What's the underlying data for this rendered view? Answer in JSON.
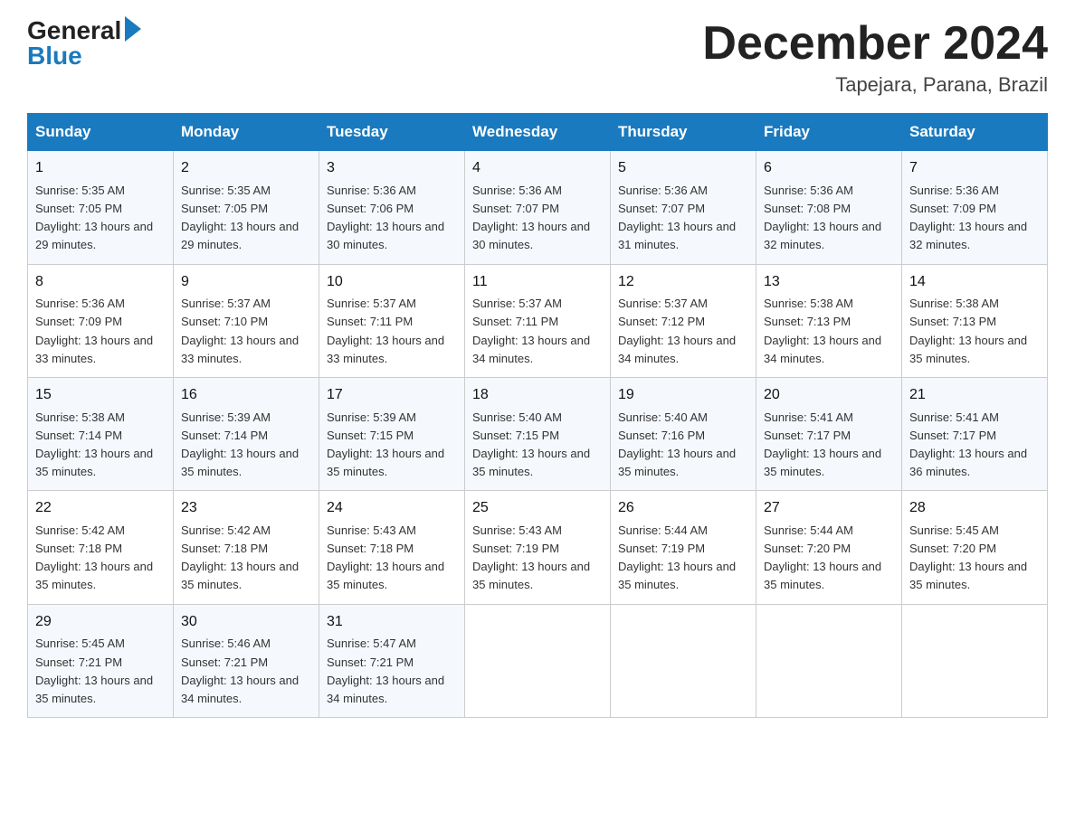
{
  "header": {
    "logo": {
      "general": "General",
      "blue": "Blue"
    },
    "title": "December 2024",
    "location": "Tapejara, Parana, Brazil"
  },
  "calendar": {
    "days_of_week": [
      "Sunday",
      "Monday",
      "Tuesday",
      "Wednesday",
      "Thursday",
      "Friday",
      "Saturday"
    ],
    "weeks": [
      [
        {
          "day": "1",
          "sunrise": "5:35 AM",
          "sunset": "7:05 PM",
          "daylight": "13 hours and 29 minutes."
        },
        {
          "day": "2",
          "sunrise": "5:35 AM",
          "sunset": "7:05 PM",
          "daylight": "13 hours and 29 minutes."
        },
        {
          "day": "3",
          "sunrise": "5:36 AM",
          "sunset": "7:06 PM",
          "daylight": "13 hours and 30 minutes."
        },
        {
          "day": "4",
          "sunrise": "5:36 AM",
          "sunset": "7:07 PM",
          "daylight": "13 hours and 30 minutes."
        },
        {
          "day": "5",
          "sunrise": "5:36 AM",
          "sunset": "7:07 PM",
          "daylight": "13 hours and 31 minutes."
        },
        {
          "day": "6",
          "sunrise": "5:36 AM",
          "sunset": "7:08 PM",
          "daylight": "13 hours and 32 minutes."
        },
        {
          "day": "7",
          "sunrise": "5:36 AM",
          "sunset": "7:09 PM",
          "daylight": "13 hours and 32 minutes."
        }
      ],
      [
        {
          "day": "8",
          "sunrise": "5:36 AM",
          "sunset": "7:09 PM",
          "daylight": "13 hours and 33 minutes."
        },
        {
          "day": "9",
          "sunrise": "5:37 AM",
          "sunset": "7:10 PM",
          "daylight": "13 hours and 33 minutes."
        },
        {
          "day": "10",
          "sunrise": "5:37 AM",
          "sunset": "7:11 PM",
          "daylight": "13 hours and 33 minutes."
        },
        {
          "day": "11",
          "sunrise": "5:37 AM",
          "sunset": "7:11 PM",
          "daylight": "13 hours and 34 minutes."
        },
        {
          "day": "12",
          "sunrise": "5:37 AM",
          "sunset": "7:12 PM",
          "daylight": "13 hours and 34 minutes."
        },
        {
          "day": "13",
          "sunrise": "5:38 AM",
          "sunset": "7:13 PM",
          "daylight": "13 hours and 34 minutes."
        },
        {
          "day": "14",
          "sunrise": "5:38 AM",
          "sunset": "7:13 PM",
          "daylight": "13 hours and 35 minutes."
        }
      ],
      [
        {
          "day": "15",
          "sunrise": "5:38 AM",
          "sunset": "7:14 PM",
          "daylight": "13 hours and 35 minutes."
        },
        {
          "day": "16",
          "sunrise": "5:39 AM",
          "sunset": "7:14 PM",
          "daylight": "13 hours and 35 minutes."
        },
        {
          "day": "17",
          "sunrise": "5:39 AM",
          "sunset": "7:15 PM",
          "daylight": "13 hours and 35 minutes."
        },
        {
          "day": "18",
          "sunrise": "5:40 AM",
          "sunset": "7:15 PM",
          "daylight": "13 hours and 35 minutes."
        },
        {
          "day": "19",
          "sunrise": "5:40 AM",
          "sunset": "7:16 PM",
          "daylight": "13 hours and 35 minutes."
        },
        {
          "day": "20",
          "sunrise": "5:41 AM",
          "sunset": "7:17 PM",
          "daylight": "13 hours and 35 minutes."
        },
        {
          "day": "21",
          "sunrise": "5:41 AM",
          "sunset": "7:17 PM",
          "daylight": "13 hours and 36 minutes."
        }
      ],
      [
        {
          "day": "22",
          "sunrise": "5:42 AM",
          "sunset": "7:18 PM",
          "daylight": "13 hours and 35 minutes."
        },
        {
          "day": "23",
          "sunrise": "5:42 AM",
          "sunset": "7:18 PM",
          "daylight": "13 hours and 35 minutes."
        },
        {
          "day": "24",
          "sunrise": "5:43 AM",
          "sunset": "7:18 PM",
          "daylight": "13 hours and 35 minutes."
        },
        {
          "day": "25",
          "sunrise": "5:43 AM",
          "sunset": "7:19 PM",
          "daylight": "13 hours and 35 minutes."
        },
        {
          "day": "26",
          "sunrise": "5:44 AM",
          "sunset": "7:19 PM",
          "daylight": "13 hours and 35 minutes."
        },
        {
          "day": "27",
          "sunrise": "5:44 AM",
          "sunset": "7:20 PM",
          "daylight": "13 hours and 35 minutes."
        },
        {
          "day": "28",
          "sunrise": "5:45 AM",
          "sunset": "7:20 PM",
          "daylight": "13 hours and 35 minutes."
        }
      ],
      [
        {
          "day": "29",
          "sunrise": "5:45 AM",
          "sunset": "7:21 PM",
          "daylight": "13 hours and 35 minutes."
        },
        {
          "day": "30",
          "sunrise": "5:46 AM",
          "sunset": "7:21 PM",
          "daylight": "13 hours and 34 minutes."
        },
        {
          "day": "31",
          "sunrise": "5:47 AM",
          "sunset": "7:21 PM",
          "daylight": "13 hours and 34 minutes."
        },
        null,
        null,
        null,
        null
      ]
    ]
  }
}
